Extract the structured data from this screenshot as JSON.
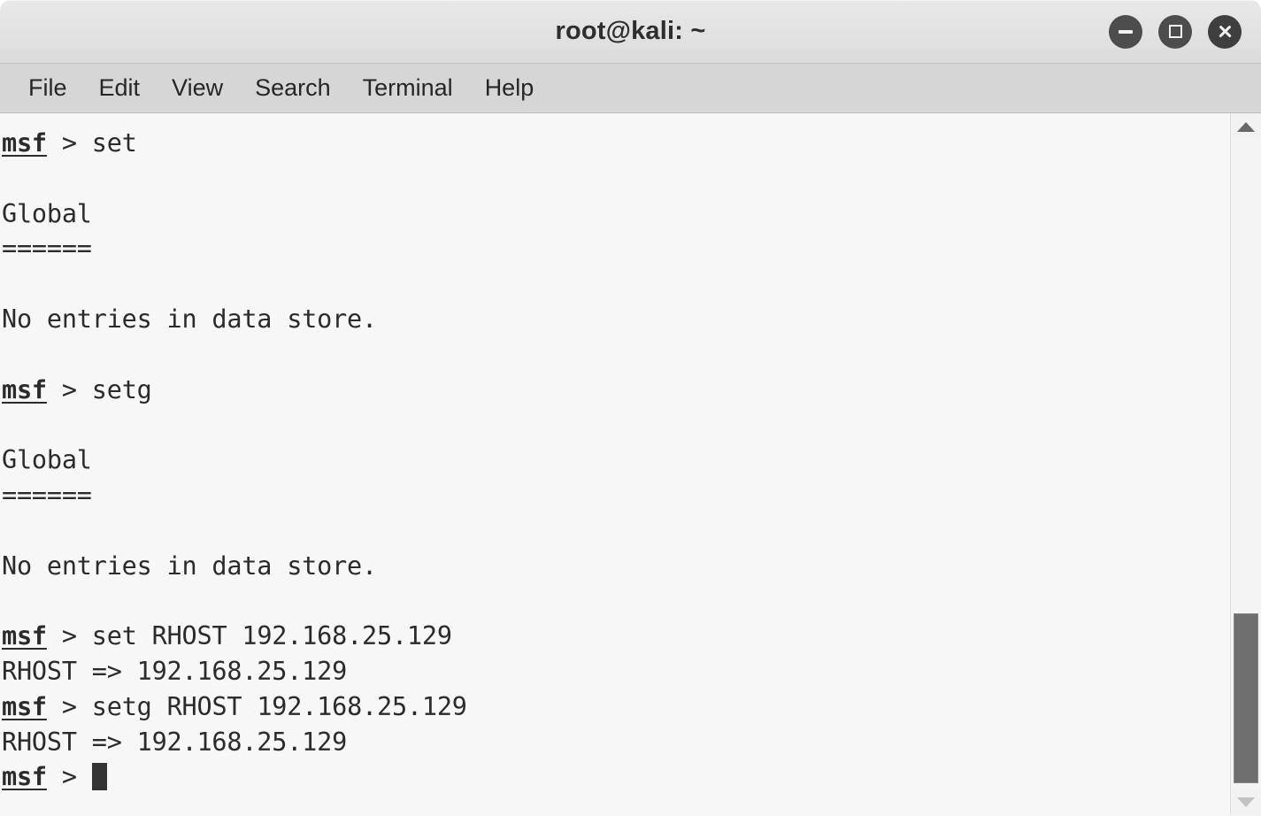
{
  "window": {
    "title": "root@kali: ~",
    "controls": {
      "minimize_label": "Minimize",
      "maximize_label": "Maximize",
      "close_label": "Close"
    }
  },
  "menubar": {
    "items": [
      {
        "label": "File"
      },
      {
        "label": "Edit"
      },
      {
        "label": "View"
      },
      {
        "label": "Search"
      },
      {
        "label": "Terminal"
      },
      {
        "label": "Help"
      }
    ]
  },
  "terminal": {
    "prompt_host": "msf",
    "prompt_symbol": " > ",
    "lines": [
      {
        "type": "prompt",
        "command": "set"
      },
      {
        "type": "blank",
        "text": ""
      },
      {
        "type": "output",
        "text": "Global"
      },
      {
        "type": "output",
        "text": "======"
      },
      {
        "type": "blank",
        "text": ""
      },
      {
        "type": "output",
        "text": "No entries in data store."
      },
      {
        "type": "blank",
        "text": ""
      },
      {
        "type": "prompt",
        "command": "setg"
      },
      {
        "type": "blank",
        "text": ""
      },
      {
        "type": "output",
        "text": "Global"
      },
      {
        "type": "output",
        "text": "======"
      },
      {
        "type": "blank",
        "text": ""
      },
      {
        "type": "output",
        "text": "No entries in data store."
      },
      {
        "type": "blank",
        "text": ""
      },
      {
        "type": "prompt",
        "command": "set RHOST 192.168.25.129"
      },
      {
        "type": "output",
        "text": "RHOST => 192.168.25.129"
      },
      {
        "type": "prompt",
        "command": "setg RHOST 192.168.25.129"
      },
      {
        "type": "output",
        "text": "RHOST => 192.168.25.129"
      },
      {
        "type": "prompt",
        "command": "",
        "cursor": true
      }
    ]
  },
  "scrollbar": {
    "up_arrow": "scroll-up",
    "down_arrow": "scroll-down",
    "thumb_label": "scroll-thumb"
  },
  "colors": {
    "titlebar_bg": "#e3e3e3",
    "menubar_bg": "#d6d6d6",
    "terminal_bg": "#f7f7f7",
    "terminal_fg": "#2b2b2b",
    "scrollbar_thumb": "#6e6e6e",
    "window_button": "#4d4d4d"
  }
}
